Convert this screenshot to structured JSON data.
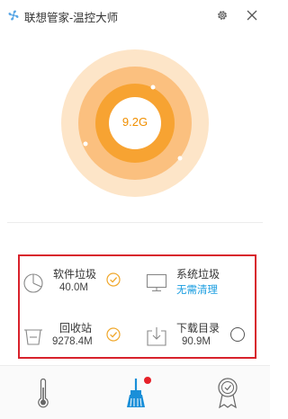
{
  "app": {
    "title": "联想管家-温控大师",
    "icons": {
      "logo": "fan-logo-icon",
      "settings": "gear-icon",
      "close": "close-icon"
    }
  },
  "usage": {
    "value": "9.2G"
  },
  "items": [
    {
      "name": "软件垃圾",
      "size": "40.0M",
      "icon": "pie-icon",
      "status": "checked"
    },
    {
      "name": "系统垃圾",
      "status_text": "无需清理",
      "icon": "monitor-icon",
      "status": "none"
    },
    {
      "name": "回收站",
      "size": "9278.4M",
      "icon": "recycle-bin-icon",
      "status": "checked"
    },
    {
      "name": "下载目录",
      "size": "90.9M",
      "icon": "download-box-icon",
      "status": "unchecked"
    }
  ],
  "nav": {
    "tabs": [
      {
        "icon": "thermometer-icon",
        "active": false
      },
      {
        "icon": "broom-icon",
        "active": true
      },
      {
        "icon": "award-icon",
        "active": false
      }
    ]
  },
  "colors": {
    "accent": "#1a9de0",
    "ring_outer": "#fde5c8",
    "ring_mid": "#fbc07f",
    "ring_inner": "#f7a332",
    "core_text": "#f08f00",
    "check": "#f0a72a",
    "alert": "#e62129"
  }
}
